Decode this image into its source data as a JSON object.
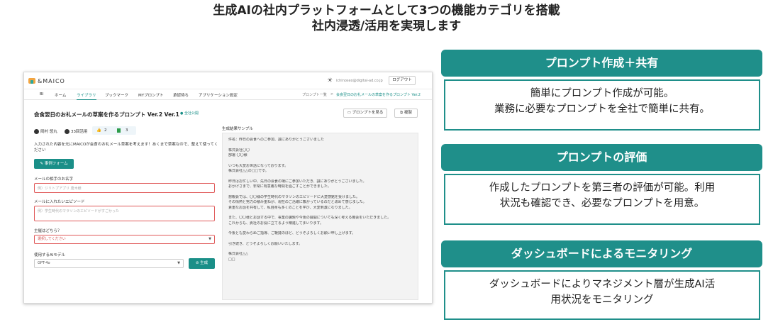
{
  "headline": {
    "line1": "生成AIの社内プラットフォームとして3つの機能カテゴリを搭載",
    "line2": "社内浸透/活用を実現します"
  },
  "app": {
    "logo_text": "&MAICO",
    "account_email": "ichinoseo@digital-ad.co.jp",
    "logout_label": "ログアウト",
    "nav": [
      "BI",
      "ホーム",
      "ライブラリ",
      "ブックマーク",
      "MYプロンプト",
      "承認待ち",
      "アプリケーション設定"
    ],
    "nav_active_index": 2,
    "breadcrumb": {
      "parent": "プロンプト一覧",
      "separator": ">",
      "current": "会食翌日のお礼メールの草案を作るプロンプト Ver.2"
    },
    "prompt_title": "会食翌日のお礼メールの草案を作るプロンプト Ver.2 Ver.1",
    "prompt_badge": "● 全社公開",
    "see_prompt_label": "プロンプトを見る",
    "copy_label": "複製",
    "author": "岡村 悠丸",
    "uses": "33回活用",
    "likes": "2",
    "flags": "3",
    "intro_text": "入力された内容を元にMAICOが会食のお礼メール草案を考えます！あくまで草案なので、整えて使ってください",
    "example_button": "事例フォーム",
    "fields": {
      "partner_label": "メールの相手のお名字",
      "partner_placeholder": "例）ジリトプアプリ 唐木様",
      "episode_label": "メールに入れたいエピソード",
      "episode_placeholder": "例）学生時代のマラソンのエピソードがすごかった",
      "which_label": "主催はどちら？",
      "which_placeholder": "選択してください",
      "model_label": "使用するAIモデル",
      "model_value": "GPT-4o",
      "generate_label": "生成"
    },
    "output": {
      "label": "生成結果サンプル",
      "lines": [
        "件名：昨日の会食へのご参加、誠にありがとうございました",
        "",
        "株式会社〇〇",
        "部署 〇〇様",
        "",
        "いつも大変お世話になっております。",
        "株式会社△△の□□です。",
        "",
        "昨日はお忙しい中、先日の会食の場にご参加いただき、誠にありがとうございました。",
        "おかげさまで、非常に有意義な時間を過ごすことができました。",
        "",
        "懇親会では、〇〇様の学生時代のマラソンのエピソードに大変感銘を受けました。",
        "その情熱と努力の積み重ねが、現在のご活躍に繋がっているのだと改めて感じました。",
        "貴重なお話を共有して、私自身も多くのことを学び、大変刺激になりました。",
        "",
        "また、〇〇様とお話する中で、事業の課題や今後の展開についても深く考える機会をいただきました。",
        "これからも、貴社のお役に立てるよう精進してまいります。",
        "",
        "今後とも変わらぬご指導、ご鞭撻のほど、どうぞよろしくお願い申し上げます。",
        "",
        "引き続き、どうぞよろしくお願いいたします。",
        "",
        "株式会社△△",
        "□□"
      ]
    }
  },
  "panels": [
    {
      "title": "プロンプト作成＋共有",
      "body": [
        "簡単にプロンプト作成が可能。",
        "業務に必要なプロンプトを全社で簡単に共有。"
      ]
    },
    {
      "title": "プロンプトの評価",
      "body": [
        "作成したプロンプトを第三者の評価が可能。利用",
        "状況も確認でき、必要なプロンプトを用意。"
      ]
    },
    {
      "title": "ダッシュボードによるモニタリング",
      "body": [
        "ダッシュボードによりマネジメント層が生成AI活",
        "用状況をモニタリング"
      ]
    }
  ],
  "colors": {
    "brand_teal": "#1f8f8a",
    "error_red": "#e05a5a"
  }
}
